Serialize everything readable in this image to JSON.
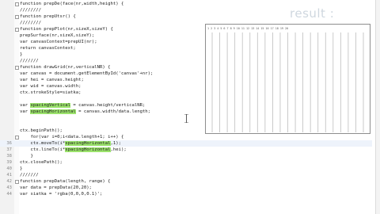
{
  "editor": {
    "lines": [
      {
        "n": "",
        "fold": true,
        "code": "function prepDe(face(nr,width,height) {"
      },
      {
        "n": "",
        "fold": false,
        "code": "////////"
      },
      {
        "n": "",
        "fold": true,
        "code": "function prepUtsr() {"
      },
      {
        "n": "",
        "fold": false,
        "code": "////////"
      },
      {
        "n": "",
        "fold": true,
        "code": "function prepPlot(nr,sizeX,sizeY) {"
      },
      {
        "n": "",
        "fold": false,
        "code": "prepSurface(nr,sizeX,sizeY);"
      },
      {
        "n": "",
        "fold": false,
        "code": "var canvasContext=prepUI(nr);"
      },
      {
        "n": "",
        "fold": false,
        "code": "return canvasContext;"
      },
      {
        "n": "",
        "fold": false,
        "code": "}"
      },
      {
        "n": "",
        "fold": false,
        "code": "///////"
      },
      {
        "n": "",
        "fold": true,
        "code": "function drawGrid(nr,verticalNR) {"
      },
      {
        "n": "",
        "fold": false,
        "code": "var canvas = document.getElementById('canvas'+nr);"
      },
      {
        "n": "",
        "fold": false,
        "code": "var hei = canvas.height;"
      },
      {
        "n": "",
        "fold": false,
        "code": "var wid = canvas.width;"
      },
      {
        "n": "",
        "fold": false,
        "code": "ctx.strokeStyle=siatka;"
      },
      {
        "n": "",
        "fold": false,
        "code": ""
      },
      {
        "n": "",
        "fold": false,
        "code": "var spacingVertical = canvas.height/verticalNR;"
      },
      {
        "n": "",
        "fold": false,
        "code": "var spacingHorizontal = canvas.width/data.length;"
      },
      {
        "n": "",
        "fold": false,
        "code": ""
      },
      {
        "n": "",
        "fold": false,
        "code": ""
      },
      {
        "n": "",
        "fold": false,
        "code": "ctx.beginPath();"
      },
      {
        "n": "",
        "fold": true,
        "code": "    for(var i=0;i<data.length+1; i++) {"
      },
      {
        "n": "36",
        "fold": false,
        "code": "    ctx.moveTo(i*spacingHorizontal,1);"
      },
      {
        "n": "37",
        "fold": false,
        "code": "    ctx.lineTo(i*spacingHorizontal,hei);"
      },
      {
        "n": "38",
        "fold": false,
        "code": "    }"
      },
      {
        "n": "39",
        "fold": false,
        "code": "ctx.closePath();"
      },
      {
        "n": "40",
        "fold": false,
        "code": "}"
      },
      {
        "n": "41",
        "fold": false,
        "code": "///////"
      },
      {
        "n": "42",
        "fold": true,
        "code": "function prepData(length, range) {"
      },
      {
        "n": "43",
        "fold": false,
        "code": "var data = prepData(20,20);"
      },
      {
        "n": "44",
        "fold": false,
        "code": "var siatka = 'rgba(0,0,0,0.1)';"
      },
      {
        "n": "",
        "fold": false,
        "code": ""
      },
      {
        "n": "",
        "fold": false,
        "code": ""
      }
    ]
  },
  "result": {
    "label": "result :",
    "canvas_numbers": "1 2 3 4 5 6 7 8 9 10 11 12 13 14 15 16 17 18 19 20",
    "vertical_line_count": 21
  },
  "colors": {
    "highlight": "#9be36b",
    "grid_line": "#bdbdbd",
    "frame": "#8d8d8d"
  }
}
